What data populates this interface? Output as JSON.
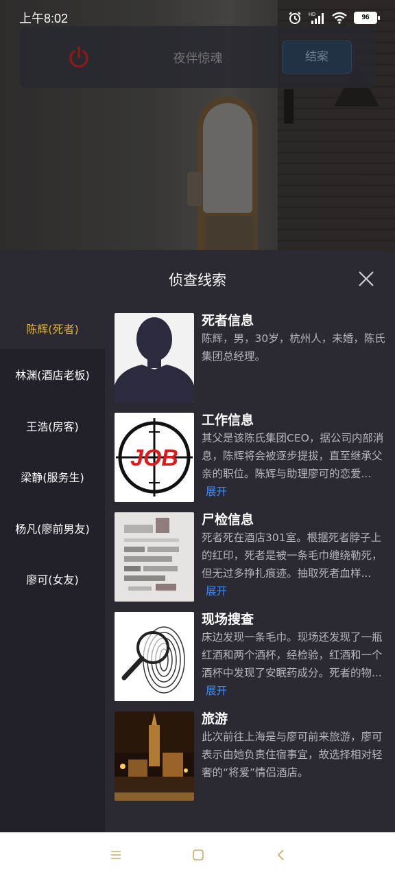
{
  "status": {
    "time": "上午8:02",
    "battery": "96",
    "hd_label": "HD"
  },
  "topbar": {
    "title": "夜伴惊魂",
    "end_button": "结案",
    "power_icon": "power-icon",
    "power_color": "#8b1a1a"
  },
  "sheet": {
    "title": "侦查线索",
    "close_icon": "close-icon"
  },
  "sidebar": {
    "items": [
      {
        "label": "陈辉(死者)",
        "active": true
      },
      {
        "label": "林渊(酒店老板)"
      },
      {
        "label": "王浩(房客)"
      },
      {
        "label": "梁静(服务生)"
      },
      {
        "label": "杨凡(廖前男友)"
      },
      {
        "label": "廖可(女友)"
      }
    ],
    "active_color": "#e0b33c"
  },
  "clues": [
    {
      "title": "死者信息",
      "desc": "陈辉，男，30岁，杭州人，未婚，陈氏集团总经理。",
      "expand": ""
    },
    {
      "title": "工作信息",
      "desc": "其父是该陈氏集团CEO，据公司内部消息，陈辉将会被逐步提拔，直至继承父亲的职位。陈辉与助理廖可的恋爱...",
      "expand": "展开"
    },
    {
      "title": "尸检信息",
      "desc": "死者死在酒店301室。根据死者脖子上的红印，死者是被一条毛巾缠绕勒死，但无过多挣扎痕迹。抽取死者血样...",
      "expand": "展开"
    },
    {
      "title": "现场搜查",
      "desc": "床边发现一条毛巾。现场还发现了一瓶红酒和两个酒杯，经检验，红酒和一个酒杯中发现了安眠药成分。死者的物...",
      "expand": "展开"
    },
    {
      "title": "旅游",
      "desc": "此次前往上海是与廖可前来旅游，廖可表示由她负责住宿事宜，故选择相对轻奢的“将爱”情侣酒店。",
      "expand": ""
    }
  ],
  "thumbs": {
    "job_text": "JOB"
  },
  "colors": {
    "link": "#3d8cff",
    "sheet_bg": "#2b2a33",
    "sidebar_bg": "#22212a"
  }
}
